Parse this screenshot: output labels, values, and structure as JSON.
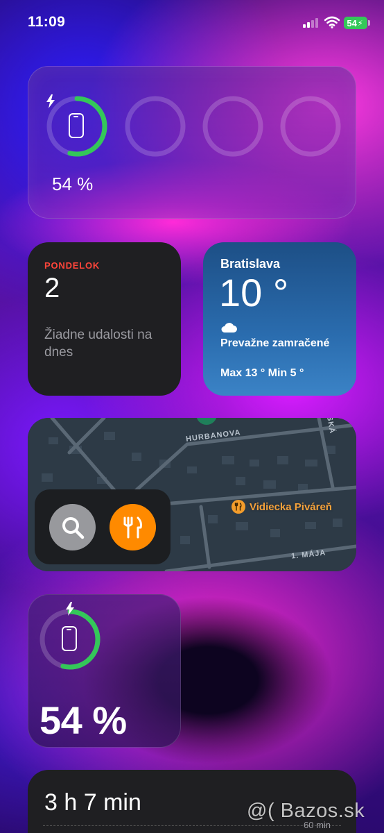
{
  "status_bar": {
    "time": "11:09",
    "battery_level": "54",
    "signal_icon": "signal-bars-icon",
    "wifi_icon": "wifi-icon",
    "charging_icon": "bolt-icon"
  },
  "batteries_widget": {
    "devices": [
      {
        "icon": "iphone-icon",
        "charging": true,
        "level": 0.54
      },
      {
        "icon": "empty-slot",
        "level": 0
      },
      {
        "icon": "empty-slot",
        "level": 0
      },
      {
        "icon": "empty-slot",
        "level": 0
      }
    ],
    "percent_label": "54 %"
  },
  "calendar_widget": {
    "weekday": "PONDELOK",
    "date": "2",
    "empty_message": "Žiadne udalosti na dnes"
  },
  "weather_widget": {
    "city": "Bratislava",
    "temperature": "10 °",
    "condition_icon": "cloud-icon",
    "condition": "Prevažne zamračené",
    "range": "Max 13 ° Min 5 °"
  },
  "map_widget": {
    "streets": [
      "HURBANOVA",
      "1. MÁJA",
      "SKÁ"
    ],
    "poi_name": "Vidiecka Piváreň",
    "poi_icon": "fork-knife-icon",
    "actions": [
      {
        "icon": "search-icon"
      },
      {
        "icon": "fork-knife-icon"
      }
    ]
  },
  "battery_widget_small": {
    "icon": "iphone-icon",
    "charging": true,
    "level": 0.54,
    "percent_label": "54 %"
  },
  "screen_time_widget": {
    "total": "3 h 7 min",
    "axis_label": "60 min"
  },
  "watermark": "@( Bazos.sk",
  "colors": {
    "charge_ring": "#34c759",
    "calendar_accent": "#ff453a",
    "poi_accent": "#f39c2b",
    "weather_bg": "#2a6cae"
  }
}
